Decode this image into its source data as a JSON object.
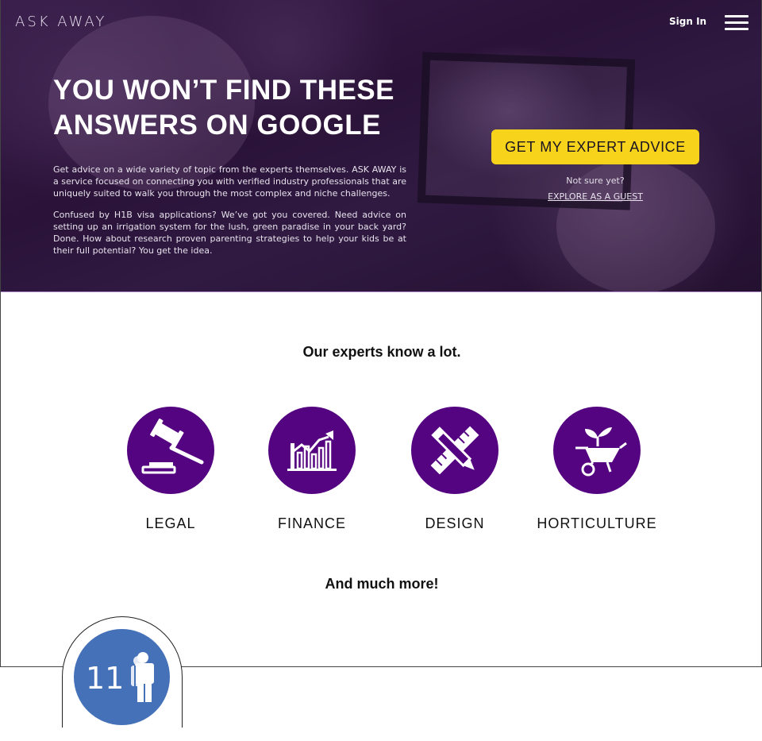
{
  "header": {
    "logo": "ASK AWAY",
    "signin_label": "Sign In",
    "menu_icon": "hamburger-menu-icon"
  },
  "hero": {
    "headline": "YOU WON’T FIND THESE ANSWERS ON GOOGLE",
    "paragraph_1": "Get advice on a wide variety of topic from the experts themselves. ASK AWAY is a service focused on connecting you with verified industry professionals that are uniquely suited to walk you through the most complex and niche challenges.",
    "paragraph_2": "Confused by H1B visa applications? We’ve got you covered. Need advice on setting up an irrigation system for the lush, green paradise in your back yard? Done. How about research proven parenting strategies to help your kids be at their full potential? You get the idea.",
    "cta_label": "GET MY EXPERT ADVICE",
    "not_sure": "Not sure yet?",
    "guest_link": "EXPLORE AS A GUEST"
  },
  "experts": {
    "heading": "Our experts know a lot.",
    "categories": [
      {
        "label": "LEGAL",
        "icon": "gavel-icon"
      },
      {
        "label": "FINANCE",
        "icon": "chart-icon"
      },
      {
        "label": "DESIGN",
        "icon": "pencil-ruler-icon"
      },
      {
        "label": "HORTICULTURE",
        "icon": "wheelbarrow-plant-icon"
      }
    ],
    "more": "And much more!"
  },
  "badge": {
    "count": "11",
    "icon": "people-icon"
  },
  "colors": {
    "accent_yellow": "#f7d31c",
    "category_purple": "#550481",
    "badge_blue": "#4571b9"
  }
}
